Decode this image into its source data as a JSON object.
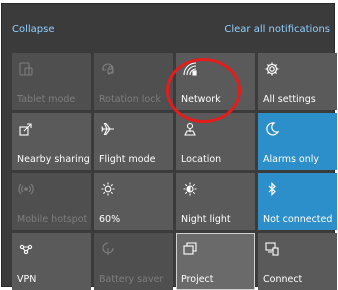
{
  "header": {
    "collapse_label": "Collapse",
    "clear_label": "Clear all notifications"
  },
  "tiles": [
    {
      "label": "Tablet mode",
      "icon": "tablet-mode-icon",
      "state": "disabled"
    },
    {
      "label": "Rotation lock",
      "icon": "rotation-lock-icon",
      "state": "disabled"
    },
    {
      "label": "Network",
      "icon": "network-icon",
      "state": "normal"
    },
    {
      "label": "All settings",
      "icon": "gear-icon",
      "state": "normal"
    },
    {
      "label": "Nearby sharing",
      "icon": "nearby-sharing-icon",
      "state": "normal"
    },
    {
      "label": "Flight mode",
      "icon": "airplane-icon",
      "state": "normal"
    },
    {
      "label": "Location",
      "icon": "location-icon",
      "state": "normal"
    },
    {
      "label": "Alarms only",
      "icon": "moon-icon",
      "state": "active"
    },
    {
      "label": "Mobile hotspot",
      "icon": "mobile-hotspot-icon",
      "state": "disabled"
    },
    {
      "label": "60%",
      "icon": "brightness-icon",
      "state": "normal"
    },
    {
      "label": "Night light",
      "icon": "night-light-icon",
      "state": "normal"
    },
    {
      "label": "Not connected",
      "icon": "bluetooth-icon",
      "state": "active"
    },
    {
      "label": "VPN",
      "icon": "vpn-icon",
      "state": "normal"
    },
    {
      "label": "Battery saver",
      "icon": "battery-saver-icon",
      "state": "disabled"
    },
    {
      "label": "Project",
      "icon": "project-icon",
      "state": "selected"
    },
    {
      "label": "Connect",
      "icon": "connect-icon",
      "state": "normal"
    }
  ],
  "colors": {
    "panel_bg": "#3b3b3b",
    "tile_bg": "#5a5a5a",
    "accent": "#2d8fca",
    "link": "#8fd1ff",
    "annotation_circle": "#e31c1c"
  }
}
